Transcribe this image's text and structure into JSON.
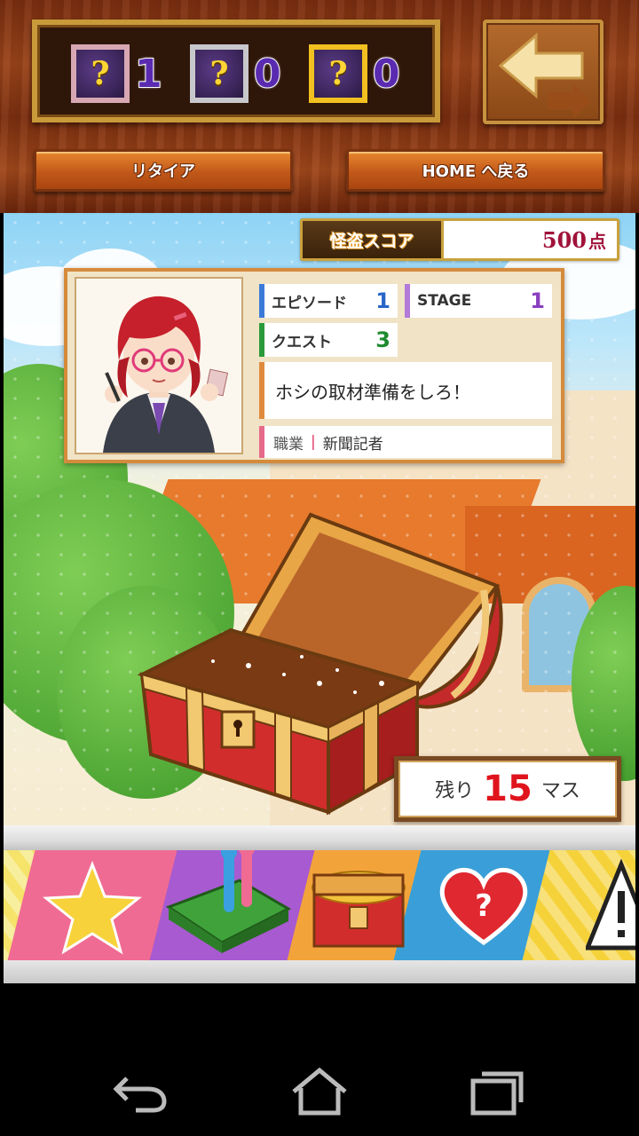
{
  "header": {
    "items": [
      {
        "symbol": "?",
        "count": "1",
        "frame": "pink"
      },
      {
        "symbol": "?",
        "count": "0",
        "frame": "silver"
      },
      {
        "symbol": "?",
        "count": "0",
        "frame": "gold"
      }
    ],
    "back_icon": "back-arrow-icon",
    "retire_label": "リタイア",
    "home_label": "HOME へ戻る"
  },
  "score": {
    "label": "怪盗スコア",
    "value": "500",
    "unit": "点"
  },
  "card": {
    "episode_label": "エピソード",
    "episode_value": "1",
    "stage_label": "STAGE",
    "stage_value": "1",
    "quest_label": "クエスト",
    "quest_value": "3",
    "mission": "ホシの取材準備をしろ！",
    "job_label": "職業",
    "job_separator": "|",
    "job_value": "新聞記者"
  },
  "remaining": {
    "prefix": "残り",
    "value": "15",
    "suffix": "マス"
  },
  "board": {
    "tiles": [
      "star-icon",
      "car-piece-icon",
      "treasure-chest-icon",
      "heart-question-icon",
      "warning-icon"
    ]
  },
  "nav": {
    "back_icon": "nav-back-icon",
    "home_icon": "nav-home-icon",
    "recents_icon": "nav-recents-icon"
  },
  "colors": {
    "wood": "#8a3c14",
    "button_orange": "#d06620",
    "score_red": "#a0123a",
    "remain_red": "#e0141c"
  }
}
